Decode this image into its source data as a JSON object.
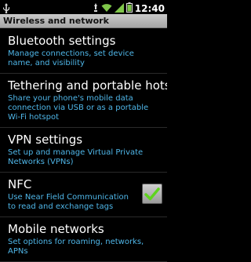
{
  "status_bar": {
    "time": "12:40",
    "icons": [
      "usb-icon",
      "notification-icon",
      "wifi-icon",
      "signal-icon",
      "battery-icon"
    ]
  },
  "header": {
    "title": "Wireless and network"
  },
  "settings": [
    {
      "title": "Bluetooth settings",
      "summary": "Manage connections, set device name, and visibility"
    },
    {
      "title": "Tethering and portable hotsp",
      "summary": "Share your phone's mobile data connection via USB or as a portable Wi-Fi hotspot"
    },
    {
      "title": "VPN settings",
      "summary": "Set up and manage Virtual Private Networks (VPNs)"
    },
    {
      "title": "NFC",
      "summary": "Use Near Field Communication to read and exchange tags",
      "checked": true
    },
    {
      "title": "Mobile networks",
      "summary": "Set options for roaming, networks, APNs"
    }
  ],
  "colors": {
    "summary": "#4fb6e8",
    "check": "#5fd41e",
    "header_bg": "#b8b8b8"
  }
}
